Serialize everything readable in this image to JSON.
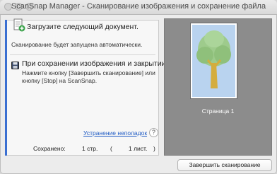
{
  "window": {
    "title": "ScanSnap Manager - Сканирование изображения и сохранение файла"
  },
  "step1": {
    "title": "Загрузите следующий документ.",
    "description": "Сканирование будет запущена автоматически."
  },
  "step2": {
    "title": "При сохранении изображения и закрытии",
    "description_line1": "Нажмите кнопку [Завершить сканирование] или",
    "description_line2": "кнопку [Stop] на ScanSnap."
  },
  "help": {
    "link": "Устранение неполадок",
    "button": "?"
  },
  "saved": {
    "label": "Сохранено:",
    "pages": "1 стр.",
    "open_paren": "(",
    "sheets": "1 лист.",
    "close_paren": ")"
  },
  "preview": {
    "page_label": "Страница 1"
  },
  "finish_button": "Завершить сканирование",
  "colors": {
    "accent": "#3b6fd1",
    "link": "#1f5bc4",
    "preview_bg": "#8c8c8c"
  }
}
